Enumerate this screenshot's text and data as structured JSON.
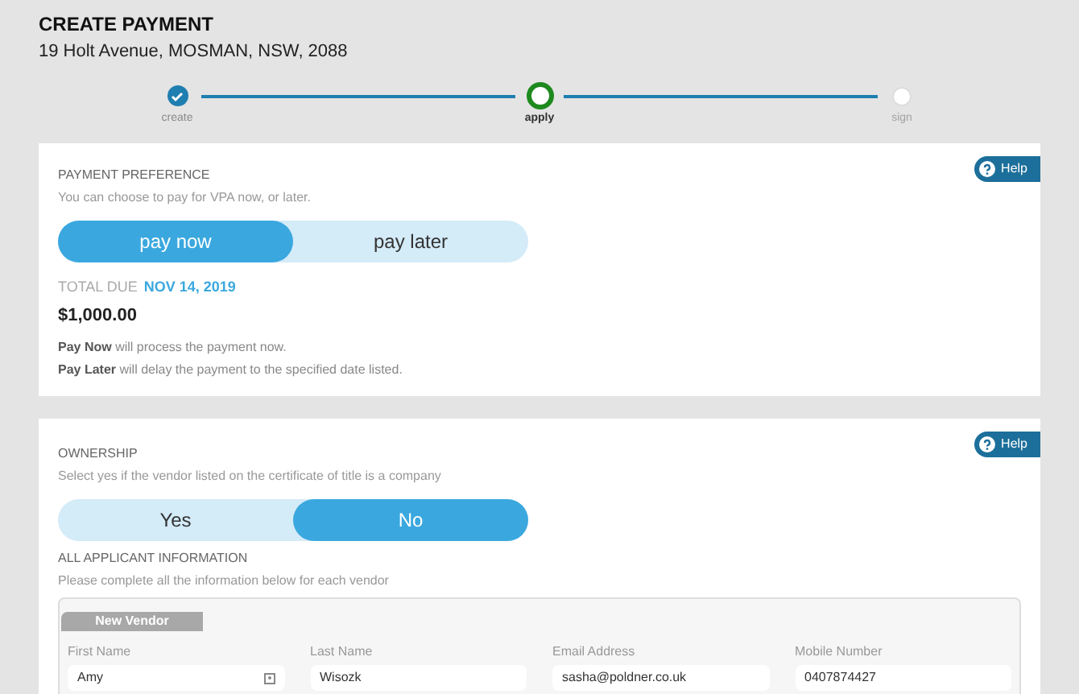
{
  "header": {
    "title": "CREATE PAYMENT",
    "address": "19 Holt Avenue, MOSMAN, NSW, 2088"
  },
  "steps": [
    {
      "label": "create",
      "done": true,
      "current": false
    },
    {
      "label": "apply",
      "done": false,
      "current": true
    },
    {
      "label": "sign",
      "done": false,
      "current": false
    }
  ],
  "payment_preference": {
    "help": "Help",
    "title": "PAYMENT PREFERENCE",
    "subtitle": "You can choose to pay for VPA now, or later.",
    "options": [
      {
        "label": "pay now",
        "selected": true
      },
      {
        "label": "pay later",
        "selected": false
      }
    ],
    "total_label": "TOTAL DUE",
    "total_date": "NOV 14, 2019",
    "amount": "$1,000.00",
    "notes": [
      "**Pay Now** will process the payment now.",
      "**Pay Later** will delay the payment to the specified date listed."
    ]
  },
  "ownership": {
    "help": "Help",
    "title": "OWNERSHIP",
    "subtitle": "Select yes if the vendor listed on the certificate of title is a company",
    "options": [
      {
        "label": "Yes",
        "selected": false
      },
      {
        "label": "No",
        "selected": true
      }
    ],
    "applicant_title": "ALL APPLICANT INFORMATION",
    "applicant_subtitle": "Please complete all the information below for each vendor",
    "vendor_tab": "New Vendor",
    "fields": [
      {
        "label": "First Name",
        "value": "Amy",
        "has_icon": true
      },
      {
        "label": "Last Name",
        "value": "Wisozk",
        "has_icon": false
      },
      {
        "label": "Email Address",
        "value": "sasha@poldner.co.uk",
        "has_icon": false
      },
      {
        "label": "Mobile Number",
        "value": "0407874427",
        "has_icon": false
      }
    ]
  }
}
